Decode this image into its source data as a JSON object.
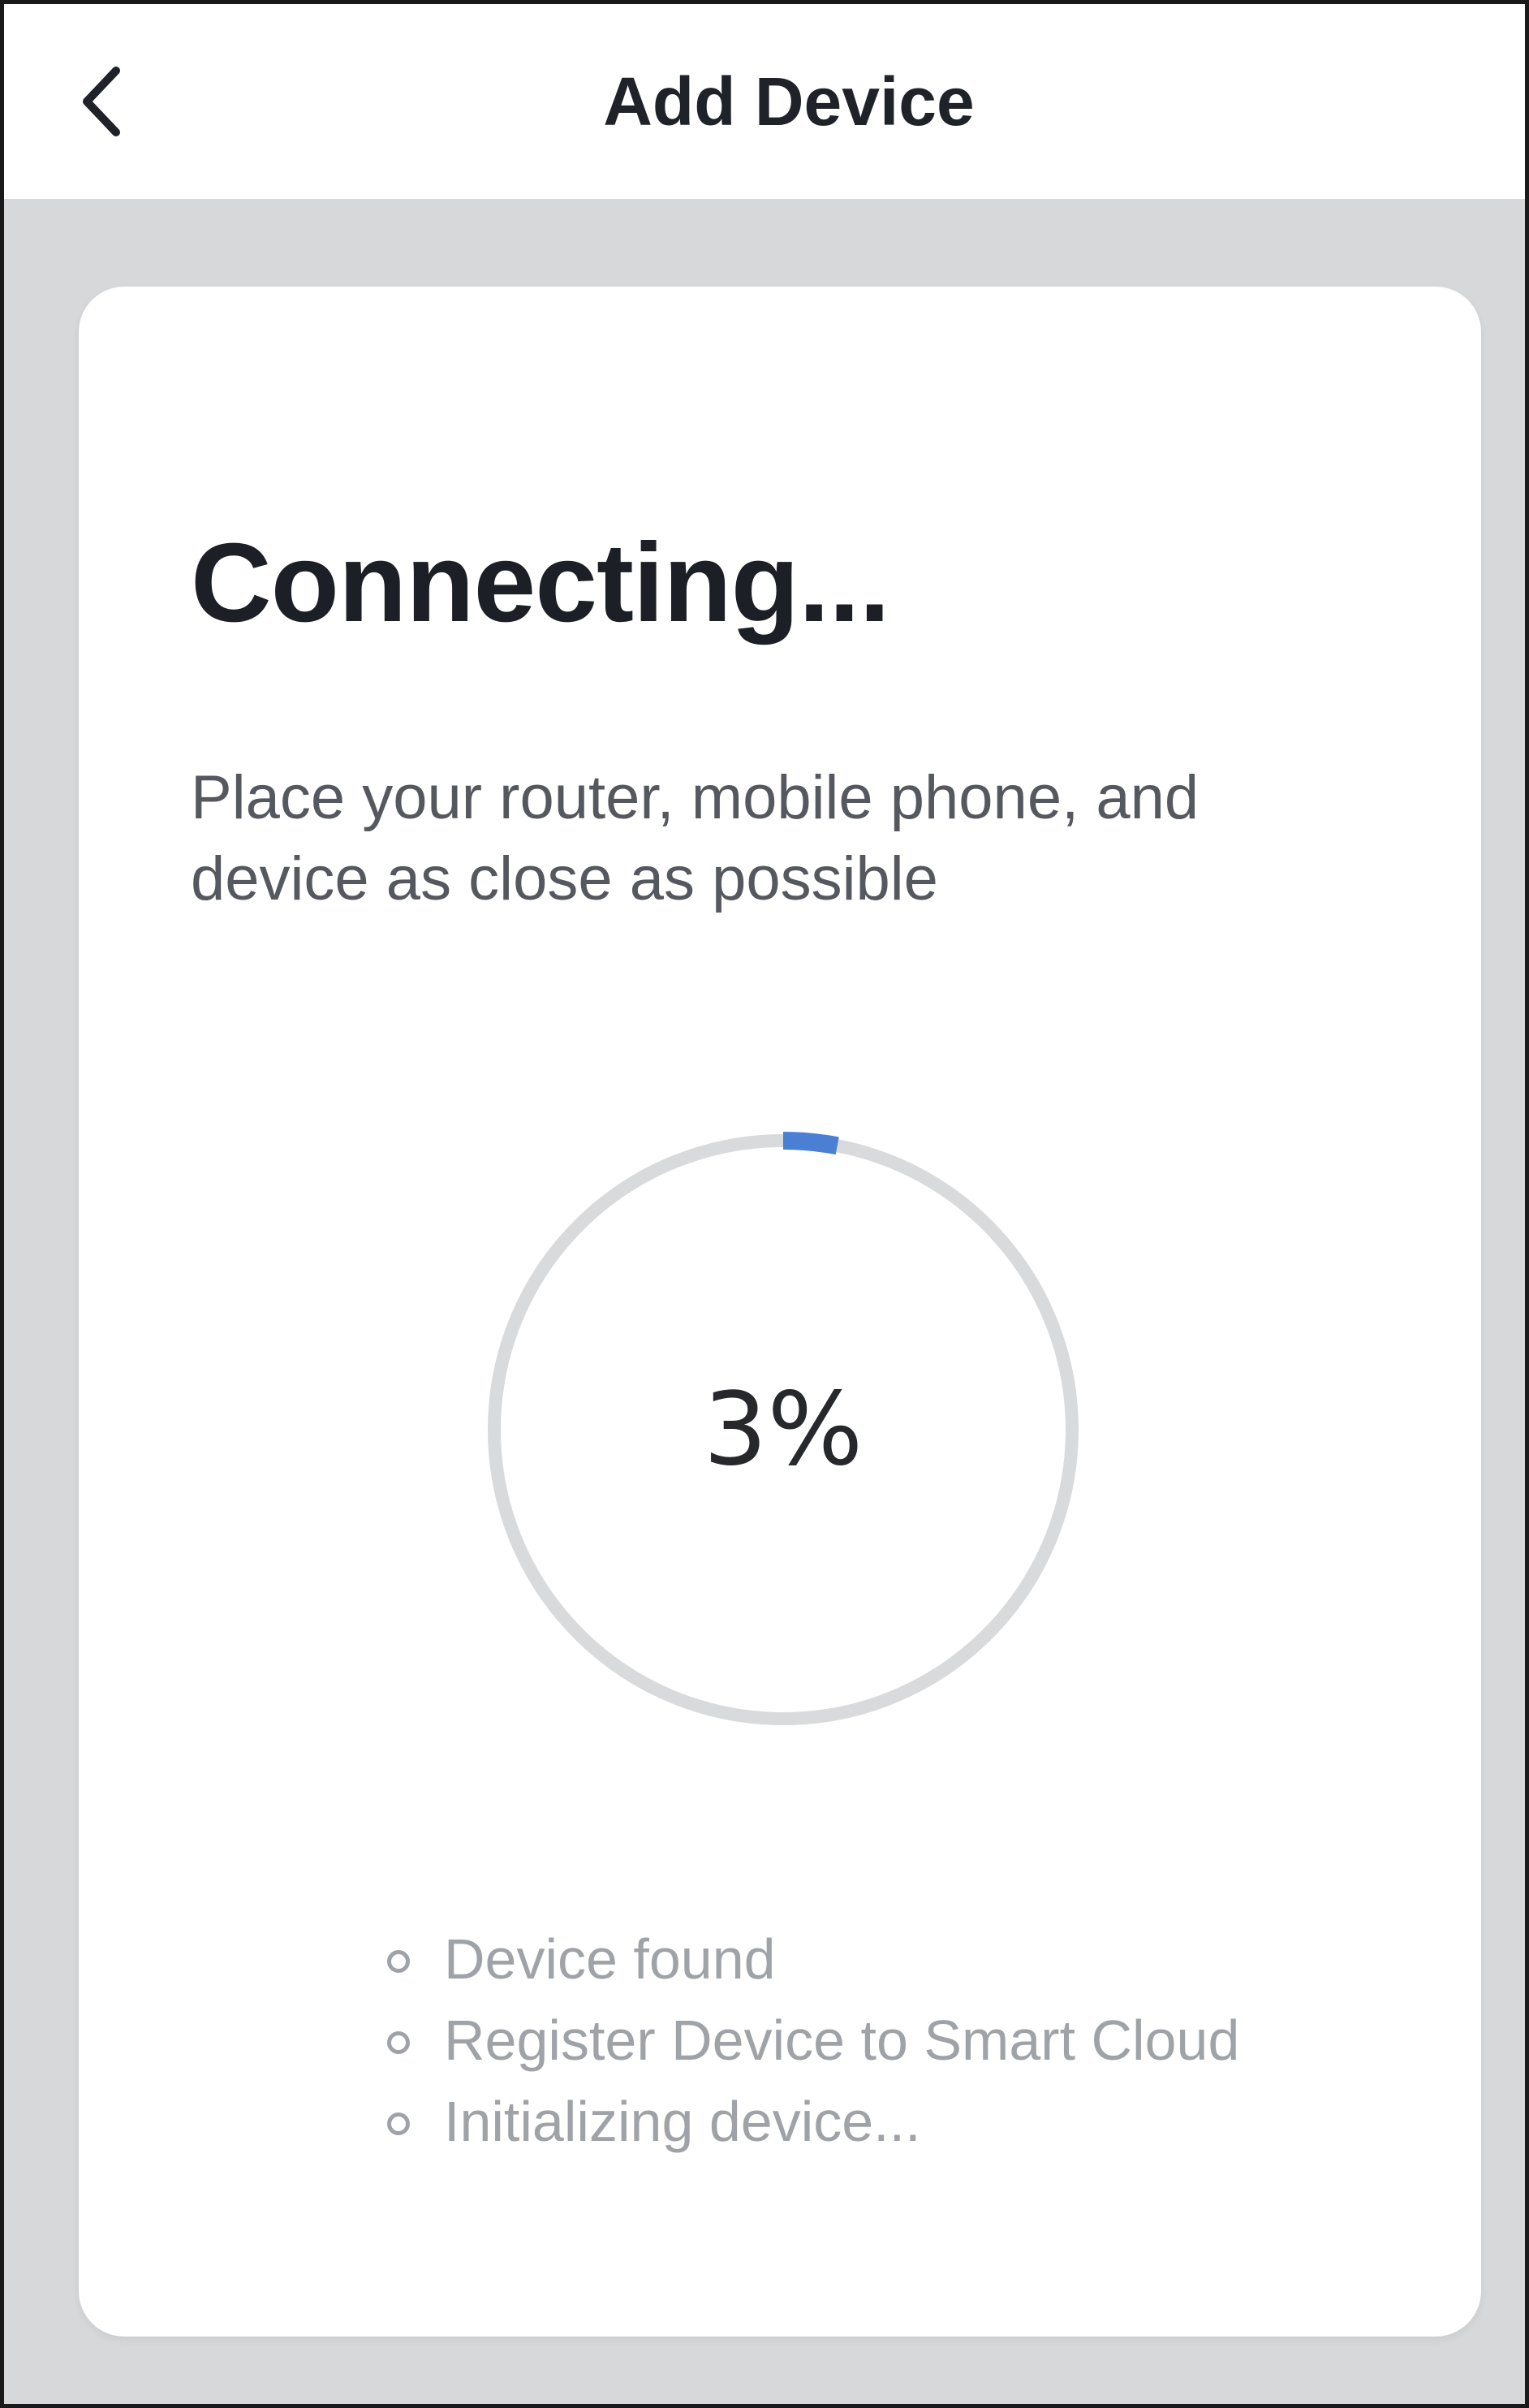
{
  "header": {
    "title": "Add Device",
    "back_icon": "chevron-left-icon"
  },
  "main": {
    "title": "Connecting...",
    "subtitle": "Place your router, mobile phone, and device as close as possible",
    "progress": {
      "value": 3,
      "label": "3%"
    },
    "steps": [
      {
        "label": "Device found"
      },
      {
        "label": "Register Device to Smart Cloud"
      },
      {
        "label": "Initializing device..."
      }
    ]
  },
  "colors": {
    "accent": "#4a7fd4",
    "track": "#d9dadb",
    "background": "#d6d8da"
  }
}
